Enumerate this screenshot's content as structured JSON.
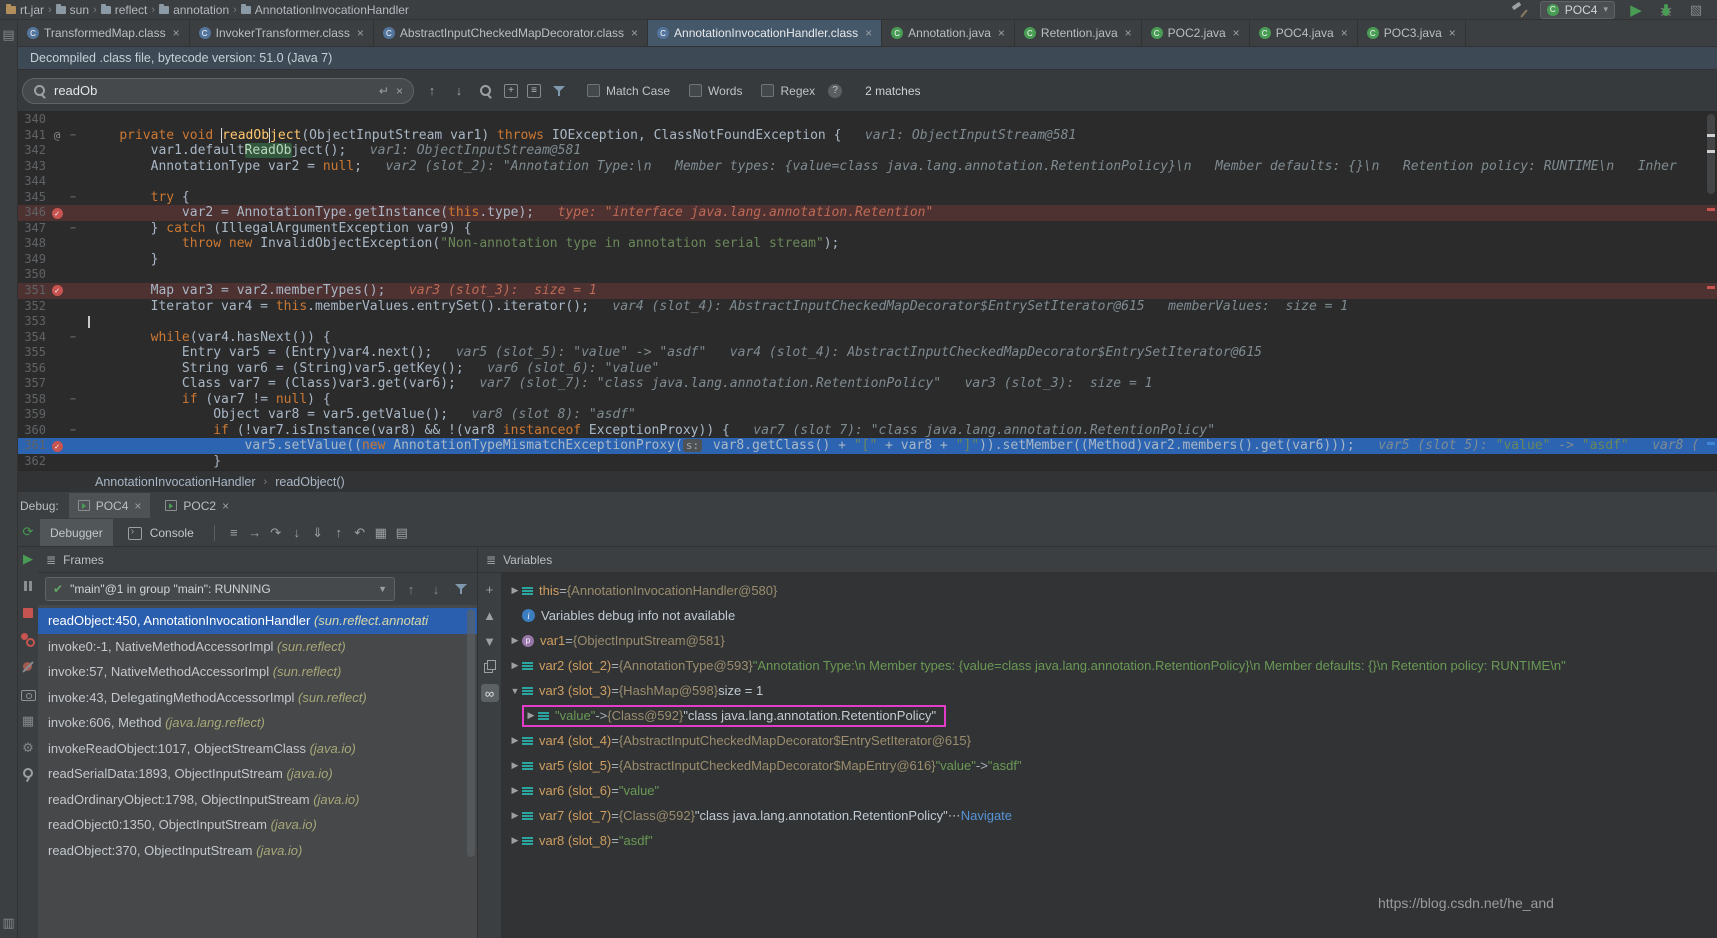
{
  "colors": {
    "exec_line_blue": "#2c64b1",
    "breakpoint_line_red": "#4e3131",
    "breakpoint_dot_red": "#c75450",
    "frame_selection_blue": "#2a5fb0",
    "highlight_magenta": "#e23cc8",
    "run_green": "#499c54",
    "string_green": "#6a8759",
    "keyword_orange": "#cc7832"
  },
  "top_bar": {
    "breadcrumbs": [
      "rt.jar",
      "sun",
      "reflect",
      "annotation",
      "AnnotationInvocationHandler"
    ],
    "run_config": "POC4"
  },
  "tabs": [
    {
      "label": "TransformedMap.class",
      "type": "class",
      "active": false
    },
    {
      "label": "InvokerTransformer.class",
      "type": "class",
      "active": false
    },
    {
      "label": "AbstractInputCheckedMapDecorator.class",
      "type": "class",
      "active": false
    },
    {
      "label": "AnnotationInvocationHandler.class",
      "type": "class",
      "active": true
    },
    {
      "label": "Annotation.java",
      "type": "java",
      "active": false
    },
    {
      "label": "Retention.java",
      "type": "java",
      "active": false
    },
    {
      "label": "POC2.java",
      "type": "java",
      "active": false
    },
    {
      "label": "POC4.java",
      "type": "java",
      "active": false
    },
    {
      "label": "POC3.java",
      "type": "java",
      "active": false
    }
  ],
  "banner": {
    "text": "Decompiled .class file, bytecode version: 51.0 (Java 7)"
  },
  "search": {
    "query": "readOb",
    "enter_icon": "↵",
    "clear_icon": "×",
    "prev": "↑",
    "next": "↓",
    "match_case": "Match Case",
    "words": "Words",
    "regex": "Regex",
    "help": "?",
    "matches": "2 matches"
  },
  "editor": {
    "lines": [
      {
        "no": 340,
        "tokens": []
      },
      {
        "no": 341,
        "fold": true,
        "mark": "@",
        "tokens": [
          [
            "p",
            "    "
          ],
          [
            "k",
            "private"
          ],
          [
            "p",
            " "
          ],
          [
            "k",
            "void"
          ],
          [
            "p",
            " "
          ],
          [
            "m1",
            "readOb"
          ],
          [
            "fn",
            "ject"
          ],
          [
            "p",
            "(ObjectInputStream var1) "
          ],
          [
            "k",
            "throws"
          ],
          [
            "p",
            " IOException, ClassNotFoundException {   "
          ],
          [
            "d",
            "var1: ObjectInputStream@581"
          ]
        ]
      },
      {
        "no": 342,
        "tokens": [
          [
            "p",
            "        var1.default"
          ],
          [
            "m2",
            "ReadOb"
          ],
          [
            "p",
            "ject();   "
          ],
          [
            "d",
            "var1: ObjectInputStream@581"
          ]
        ]
      },
      {
        "no": 343,
        "tokens": [
          [
            "p",
            "        AnnotationType var2 = "
          ],
          [
            "k",
            "null"
          ],
          [
            "p",
            ";   "
          ],
          [
            "d",
            "var2 (slot_2): \"Annotation Type:\\n   Member types: {value=class java.lang.annotation.RetentionPolicy}\\n   Member defaults: {}\\n   Retention policy: RUNTIME\\n   Inher"
          ]
        ]
      },
      {
        "no": 344,
        "tokens": []
      },
      {
        "no": 345,
        "fold": true,
        "tokens": [
          [
            "p",
            "        "
          ],
          [
            "k",
            "try"
          ],
          [
            "p",
            " {"
          ]
        ]
      },
      {
        "no": 346,
        "bp": true,
        "bg": "bp",
        "tokens": [
          [
            "p",
            "            var2 = AnnotationType.getInstance("
          ],
          [
            "k",
            "this"
          ],
          [
            "p",
            ".type);   "
          ],
          [
            "dw",
            "type: \"interface java.lang.annotation.Retention\""
          ]
        ]
      },
      {
        "no": 347,
        "fold": true,
        "tokens": [
          [
            "p",
            "        } "
          ],
          [
            "k",
            "catch"
          ],
          [
            "p",
            " (IllegalArgumentException var9) {"
          ]
        ]
      },
      {
        "no": 348,
        "tokens": [
          [
            "p",
            "            "
          ],
          [
            "k",
            "throw"
          ],
          [
            "p",
            " "
          ],
          [
            "k",
            "new"
          ],
          [
            "p",
            " InvalidObjectException("
          ],
          [
            "s",
            "\"Non-annotation type in annotation serial stream\""
          ],
          [
            "p",
            ");"
          ]
        ]
      },
      {
        "no": 349,
        "tokens": [
          [
            "p",
            "        }"
          ]
        ]
      },
      {
        "no": 350,
        "tokens": []
      },
      {
        "no": 351,
        "bp": true,
        "bg": "bp",
        "tokens": [
          [
            "p",
            "        Map var3 = var2.memberTypes();   "
          ],
          [
            "dw",
            "var3 (slot_3):  size = 1"
          ]
        ]
      },
      {
        "no": 352,
        "tokens": [
          [
            "p",
            "        Iterator var4 = "
          ],
          [
            "k",
            "this"
          ],
          [
            "p",
            ".memberValues.entrySet().iterator();   "
          ],
          [
            "d",
            "var4 (slot_4): AbstractInputCheckedMapDecorator$EntrySetIterator@615   memberValues:  size = 1"
          ]
        ]
      },
      {
        "no": 353,
        "caret": true,
        "tokens": []
      },
      {
        "no": 354,
        "fold": true,
        "tokens": [
          [
            "p",
            "        "
          ],
          [
            "k",
            "while"
          ],
          [
            "p",
            "(var4.hasNext()) {"
          ]
        ]
      },
      {
        "no": 355,
        "tokens": [
          [
            "p",
            "            Entry var5 = (Entry)var4.next();   "
          ],
          [
            "d",
            "var5 (slot_5): \"value\" -> \"asdf\"   var4 (slot_4): AbstractInputCheckedMapDecorator$EntrySetIterator@615"
          ]
        ]
      },
      {
        "no": 356,
        "tokens": [
          [
            "p",
            "            String var6 = (String)var5.getKey();   "
          ],
          [
            "d",
            "var6 (slot_6): \"value\""
          ]
        ]
      },
      {
        "no": 357,
        "tokens": [
          [
            "p",
            "            Class var7 = (Class)var3.get(var6);   "
          ],
          [
            "d",
            "var7 (slot_7): \"class java.lang.annotation.RetentionPolicy\"   var3 (slot_3):  size = 1"
          ]
        ]
      },
      {
        "no": 358,
        "fold": true,
        "tokens": [
          [
            "p",
            "            "
          ],
          [
            "k",
            "if"
          ],
          [
            "p",
            " (var7 != "
          ],
          [
            "k",
            "null"
          ],
          [
            "p",
            ") {"
          ]
        ]
      },
      {
        "no": 359,
        "tokens": [
          [
            "p",
            "                Object var8 = var5.getValue();   "
          ],
          [
            "d",
            "var8 (slot 8): \"asdf\""
          ]
        ]
      },
      {
        "no": 360,
        "fold": true,
        "tokens": [
          [
            "p",
            "                "
          ],
          [
            "k",
            "if"
          ],
          [
            "p",
            " (!var7.isInstance(var8) && !(var8 "
          ],
          [
            "k",
            "instanceof"
          ],
          [
            "p",
            " ExceptionProxy)) {   "
          ],
          [
            "d",
            "var7 (slot 7): \"class java.lang.annotation.RetentionPolicy\""
          ]
        ]
      },
      {
        "no": 361,
        "bp": true,
        "bg": "exec",
        "tokens": [
          [
            "p",
            "                    var5.setValue(("
          ],
          [
            "k",
            "new"
          ],
          [
            "p",
            " AnnotationTypeMismatchExceptionProxy("
          ],
          [
            "hint",
            "s:"
          ],
          [
            "p",
            " var8.getClass() + "
          ],
          [
            "s",
            "\"[\""
          ],
          [
            "p",
            " + var8 + "
          ],
          [
            "s",
            "\"]\""
          ],
          [
            "p",
            ")).setMember((Method)var2.members().get(var6)));   "
          ],
          [
            "d",
            "var5 (slot 5): "
          ],
          [
            "s",
            "\"value\""
          ],
          [
            "d",
            " -> "
          ],
          [
            "s",
            "\"asdf\""
          ],
          [
            "d",
            "   var8 ("
          ]
        ]
      },
      {
        "no": 362,
        "tokens": [
          [
            "p",
            "                }"
          ]
        ]
      }
    ]
  },
  "editor_breadcrumb": [
    "AnnotationInvocationHandler",
    "readObject()"
  ],
  "debug": {
    "label": "Debug:",
    "session_tabs": [
      {
        "label": "POC4",
        "active": true
      },
      {
        "label": "POC2",
        "active": false
      }
    ],
    "view_tabs": [
      {
        "label": "Debugger",
        "active": true,
        "icon": false
      },
      {
        "label": "Console",
        "active": false,
        "icon": true
      }
    ],
    "toolbar_icons": [
      {
        "name": "layout-settings-icon",
        "g": "≡"
      },
      {
        "name": "show-execution-point-icon",
        "g": "→"
      },
      {
        "name": "step-over-icon",
        "g": "↷"
      },
      {
        "name": "step-into-icon",
        "g": "↓"
      },
      {
        "name": "force-step-into-icon",
        "g": "⇓"
      },
      {
        "name": "step-out-icon",
        "g": "↑"
      },
      {
        "name": "drop-frame-icon",
        "g": "↶"
      },
      {
        "name": "view-layout-icon",
        "g": "▦"
      },
      {
        "name": "evaluate-expression-icon",
        "g": "▤"
      }
    ],
    "left_icons": [
      {
        "name": "rerun-icon",
        "g": "⟳",
        "cls": "green"
      },
      {
        "name": "resume-icon",
        "g": "▶",
        "cls": "green"
      },
      {
        "name": "pause-icon",
        "shape": "pause"
      },
      {
        "name": "stop-icon",
        "shape": "stop"
      },
      {
        "name": "view-breakpoints-icon",
        "shape": "bpview"
      },
      {
        "name": "mute-breakpoints-icon",
        "shape": "bpmute"
      },
      {
        "name": "thread-dump-icon",
        "shape": "camera"
      },
      {
        "name": "restore-layout-icon",
        "g": "▦",
        "cls": "dim"
      },
      {
        "name": "settings-gear-icon",
        "g": "⚙",
        "cls": "dim"
      },
      {
        "name": "pin-icon",
        "shape": "pin"
      }
    ],
    "frames": {
      "title": "Frames",
      "thread": "\"main\"@1 in group \"main\": RUNNING",
      "items": [
        {
          "loc": "readObject:450, AnnotationInvocationHandler ",
          "pkg": "(sun.reflect.annotati",
          "selected": true
        },
        {
          "loc": "invoke0:-1, NativeMethodAccessorImpl ",
          "pkg": "(sun.reflect)",
          "selected": false
        },
        {
          "loc": "invoke:57, NativeMethodAccessorImpl ",
          "pkg": "(sun.reflect)",
          "selected": false
        },
        {
          "loc": "invoke:43, DelegatingMethodAccessorImpl ",
          "pkg": "(sun.reflect)",
          "selected": false
        },
        {
          "loc": "invoke:606, Method ",
          "pkg": "(java.lang.reflect)",
          "selected": false
        },
        {
          "loc": "invokeReadObject:1017, ObjectStreamClass ",
          "pkg": "(java.io)",
          "selected": false
        },
        {
          "loc": "readSerialData:1893, ObjectInputStream ",
          "pkg": "(java.io)",
          "selected": false
        },
        {
          "loc": "readOrdinaryObject:1798, ObjectInputStream ",
          "pkg": "(java.io)",
          "selected": false
        },
        {
          "loc": "readObject0:1350, ObjectInputStream ",
          "pkg": "(java.io)",
          "selected": false
        },
        {
          "loc": "readObject:370, ObjectInputStream ",
          "pkg": "(java.io)",
          "selected": false
        }
      ]
    },
    "variables": {
      "title": "Variables",
      "side_icons": [
        {
          "name": "add-watch-icon",
          "g": "+"
        },
        {
          "name": "move-watch-up-icon",
          "g": "▲"
        },
        {
          "name": "move-watch-down-icon",
          "g": "▼"
        },
        {
          "name": "duplicate-watch-icon",
          "shape": "copy"
        },
        {
          "name": "show-watches-icon",
          "g": "∞",
          "pressed": true
        }
      ],
      "rows": [
        {
          "expand": "right",
          "icon": "value",
          "tokens": [
            [
              "vn",
              "this"
            ],
            [
              "vp",
              " = "
            ],
            [
              "ref",
              "{AnnotationInvocationHandler@580}"
            ]
          ]
        },
        {
          "icon": "info",
          "tokens": [
            [
              "vv",
              "Variables debug info not available"
            ]
          ]
        },
        {
          "expand": "right",
          "icon": "param",
          "tokens": [
            [
              "vn",
              "var1"
            ],
            [
              "vp",
              " = "
            ],
            [
              "ref",
              "{ObjectInputStream@581}"
            ]
          ]
        },
        {
          "expand": "right",
          "icon": "value",
          "tokens": [
            [
              "vn",
              "var2 (slot_2)"
            ],
            [
              "vp",
              " = "
            ],
            [
              "ref",
              "{AnnotationType@593}"
            ],
            [
              "vs",
              " \"Annotation Type:\\n  Member types: {value=class java.lang.annotation.RetentionPolicy}\\n  Member defaults: {}\\n  Retention policy: RUNTIME\\n\""
            ]
          ]
        },
        {
          "expand": "down",
          "icon": "value",
          "tokens": [
            [
              "vn",
              "var3 (slot_3)"
            ],
            [
              "vp",
              " = "
            ],
            [
              "ref",
              "{HashMap@598}"
            ],
            [
              "vv",
              " size = 1"
            ]
          ]
        },
        {
          "expand": "right",
          "icon": "value",
          "indent": 1,
          "highlight": true,
          "tokens": [
            [
              "vs",
              "\"value\""
            ],
            [
              "vp",
              " -> "
            ],
            [
              "ref",
              "{Class@592}"
            ],
            [
              "vv",
              " \"class java.lang.annotation.RetentionPolicy\""
            ]
          ]
        },
        {
          "expand": "right",
          "icon": "value",
          "tokens": [
            [
              "vn",
              "var4 (slot_4)"
            ],
            [
              "vp",
              " = "
            ],
            [
              "ref",
              "{AbstractInputCheckedMapDecorator$EntrySetIterator@615}"
            ]
          ]
        },
        {
          "expand": "right",
          "icon": "value",
          "tokens": [
            [
              "vn",
              "var5 (slot_5)"
            ],
            [
              "vp",
              " = "
            ],
            [
              "ref",
              "{AbstractInputCheckedMapDecorator$MapEntry@616}"
            ],
            [
              "vs",
              " \"value\""
            ],
            [
              "vp",
              " -> "
            ],
            [
              "vs",
              "\"asdf\""
            ]
          ]
        },
        {
          "expand": "right",
          "icon": "value",
          "tokens": [
            [
              "vn",
              "var6 (slot_6)"
            ],
            [
              "vp",
              " = "
            ],
            [
              "vs",
              "\"value\""
            ]
          ]
        },
        {
          "expand": "right",
          "icon": "value",
          "tokens": [
            [
              "vn",
              "var7 (slot_7)"
            ],
            [
              "vp",
              " = "
            ],
            [
              "ref",
              "{Class@592}"
            ],
            [
              "vv",
              " \"class java.lang.annotation.RetentionPolicy\""
            ],
            [
              "vp",
              " ⋯ "
            ],
            [
              "link",
              "Navigate"
            ]
          ]
        },
        {
          "expand": "right",
          "icon": "value",
          "tokens": [
            [
              "vn",
              "var8 (slot_8)"
            ],
            [
              "vp",
              " = "
            ],
            [
              "vs",
              "\"asdf\""
            ]
          ]
        }
      ]
    }
  },
  "watermark": "https://blog.csdn.net/he_and"
}
